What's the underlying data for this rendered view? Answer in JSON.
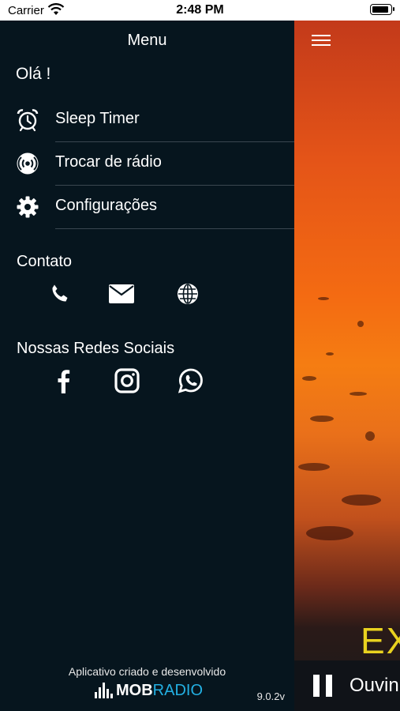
{
  "status_bar": {
    "carrier": "Carrier",
    "time": "2:48 PM"
  },
  "drawer": {
    "title": "Menu",
    "greeting": "Olá !",
    "items": [
      {
        "label": "Sleep Timer",
        "icon": "alarm-clock-icon"
      },
      {
        "label": "Trocar de rádio",
        "icon": "radio-broadcast-icon"
      },
      {
        "label": "Configurações",
        "icon": "gear-icon"
      }
    ],
    "contact": {
      "title": "Contato",
      "icons": [
        "phone-icon",
        "email-icon",
        "globe-icon"
      ]
    },
    "social": {
      "title": "Nossas Redes Sociais",
      "icons": [
        "facebook-icon",
        "instagram-icon",
        "whatsapp-icon"
      ]
    },
    "footer": {
      "credit": "Aplicativo criado e desenvolvido",
      "logo_part1": "MOB",
      "logo_part2": "RADIO",
      "version": "9.0.2v"
    }
  },
  "main": {
    "cover_text": "EX",
    "player_label": "Ouvin"
  },
  "colors": {
    "drawer_bg": "#06151e",
    "logo_accent": "#23b0e3",
    "cover_text": "#e9d21f"
  }
}
